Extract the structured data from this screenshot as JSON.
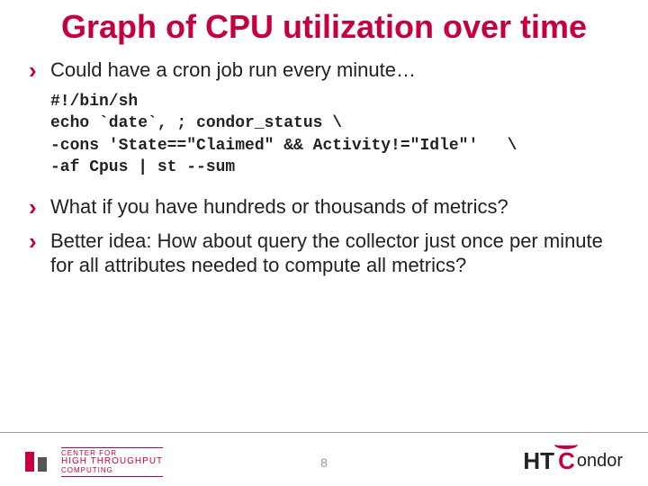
{
  "title": "Graph of CPU utilization over time",
  "bullets": {
    "b1": "Could have a cron job run every minute…",
    "b2": "What if you have hundreds or thousands  of metrics?",
    "b3": "Better idea: How about query the collector just once per minute for all attributes needed to compute all metrics?"
  },
  "code": "#!/bin/sh\necho `date`, ; condor_status \\\n-cons 'State==\"Claimed\" && Activity!=\"Idle\"'   \\\n-af Cpus | st --sum",
  "page_number": "8",
  "logo_left": {
    "l1": "CENTER FOR",
    "l2": "HIGH THROUGHPUT",
    "l3": "COMPUTING"
  },
  "logo_right": {
    "ht": "HT",
    "c": "C",
    "ondor": "ondor"
  }
}
